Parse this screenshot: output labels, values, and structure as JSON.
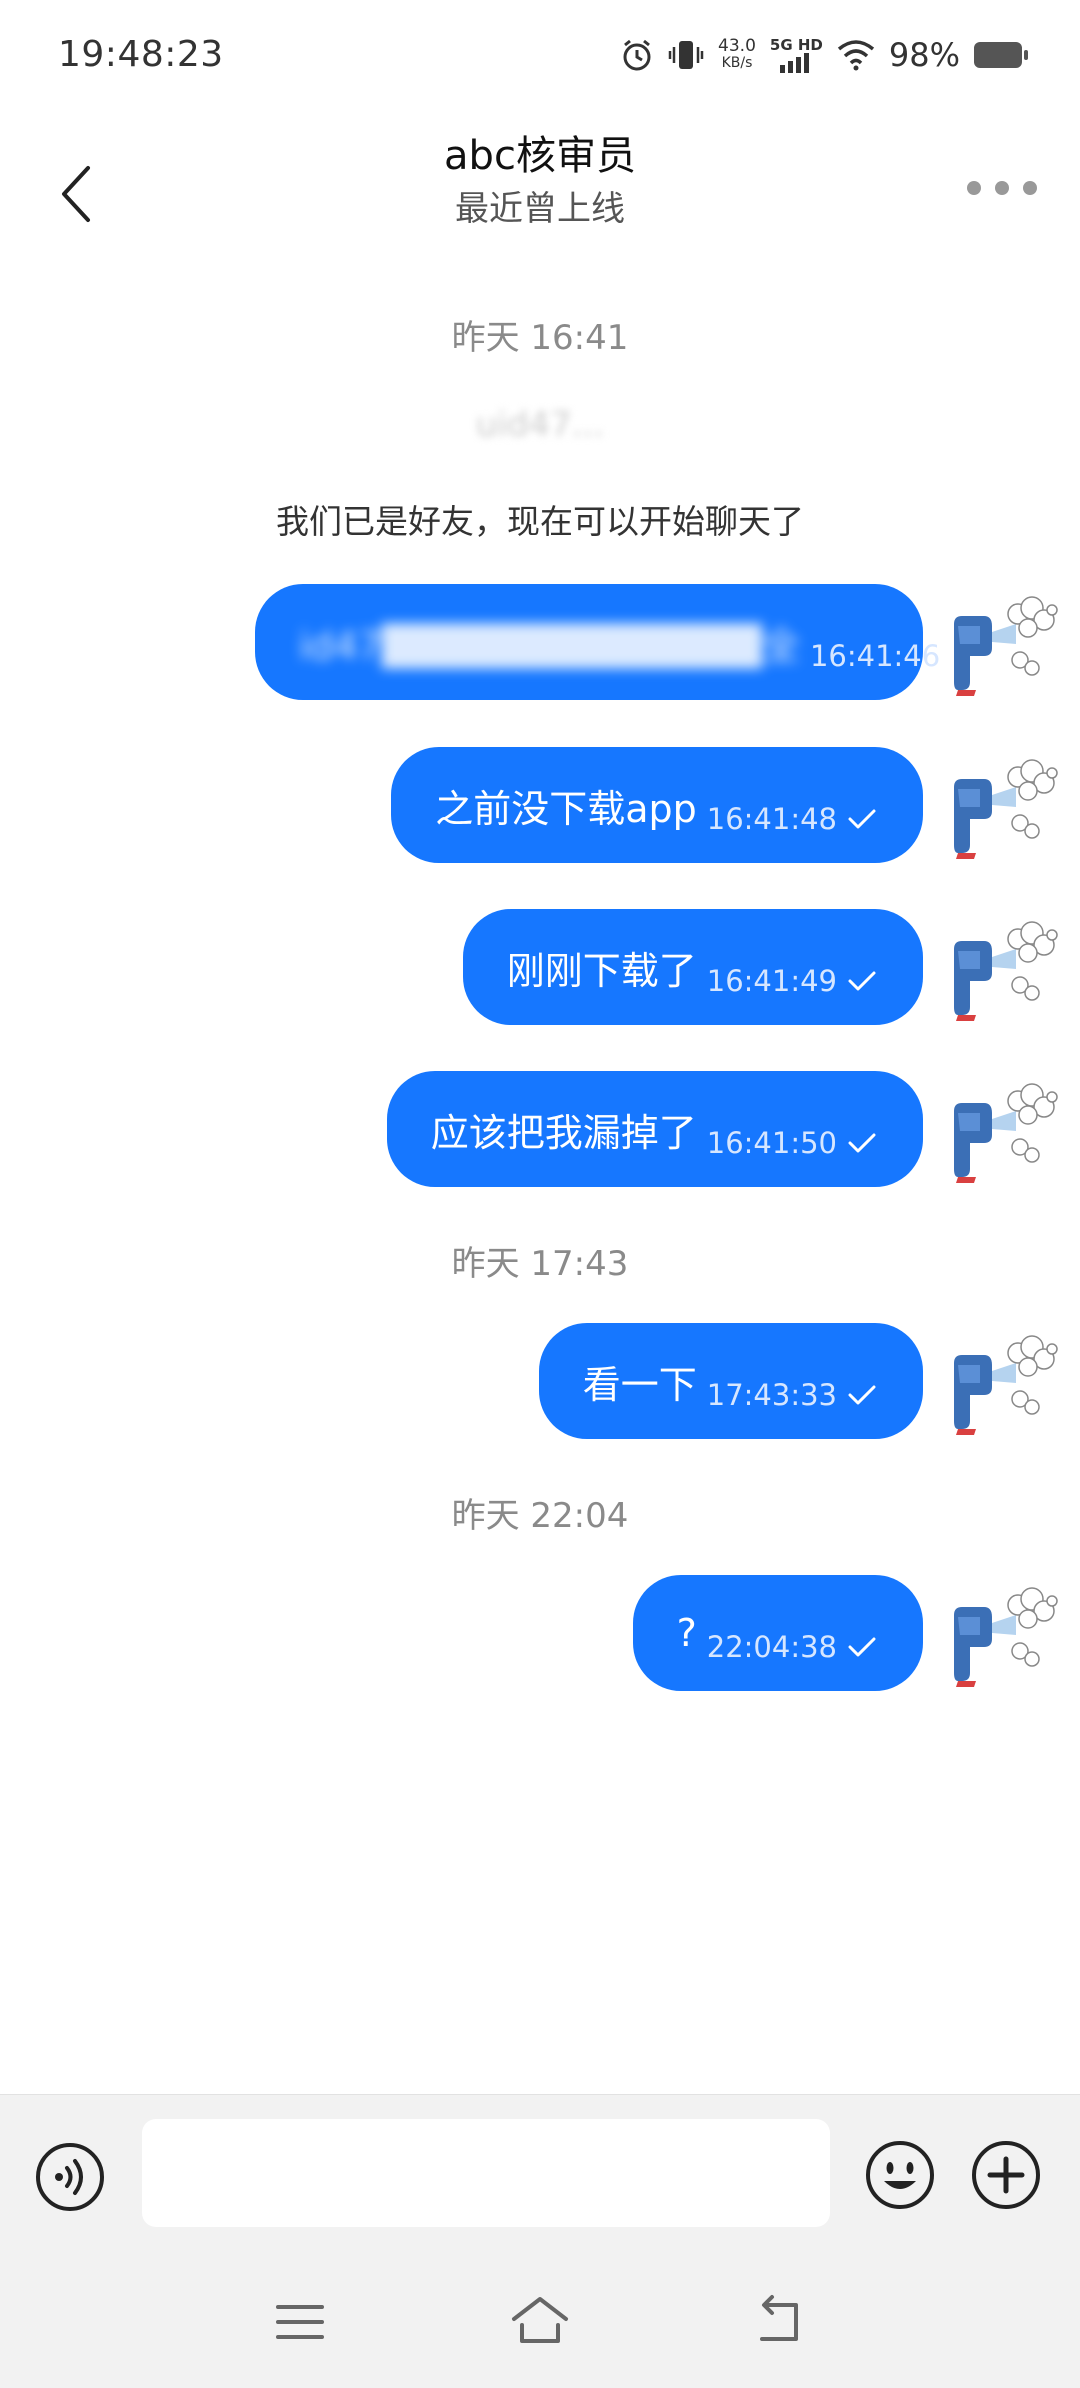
{
  "status_bar": {
    "time": "19:48:23",
    "net_speed": "43.0",
    "net_unit": "KB/s",
    "signal_label": "5G HD",
    "battery": "98%"
  },
  "header": {
    "title": "abc核审员",
    "subtitle": "最近曾上线"
  },
  "messages": {
    "sep1": "昨天 16:41",
    "system_notice": "我们已是好友，现在可以开始聊天了",
    "msg1": {
      "text": "id47█████████████全",
      "time": "16:41:46"
    },
    "msg2": {
      "text": "之前没下载app",
      "time": "16:41:48"
    },
    "msg3": {
      "text": "刚刚下载了",
      "time": "16:41:49"
    },
    "msg4": {
      "text": "应该把我漏掉了",
      "time": "16:41:50"
    },
    "sep2": "昨天 17:43",
    "msg5": {
      "text": "看一下",
      "time": "17:43:33"
    },
    "sep3": "昨天 22:04",
    "msg6": {
      "text": "?",
      "time": "22:04:38"
    }
  },
  "input": {
    "placeholder": ""
  },
  "colors": {
    "bubble": "#1677ff",
    "background": "#ffffff",
    "bar": "#f2f2f2"
  }
}
